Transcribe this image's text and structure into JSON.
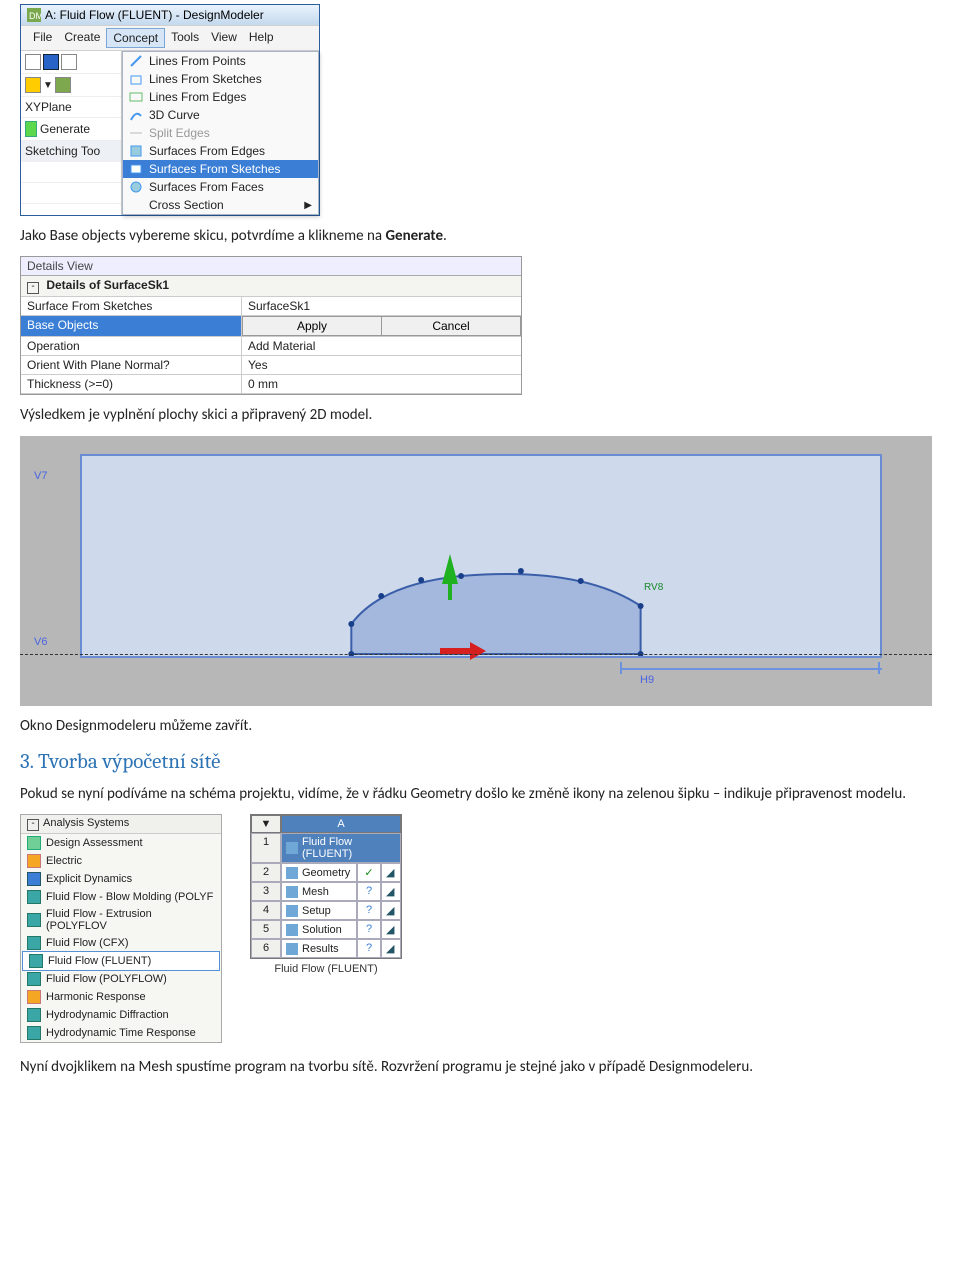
{
  "dm": {
    "title": "A: Fluid Flow (FLUENT) - DesignModeler",
    "menus": [
      "File",
      "Create",
      "Concept",
      "Tools",
      "View",
      "Help"
    ],
    "open_menu_index": 2,
    "left": {
      "plane": "XYPlane",
      "generate": "Generate",
      "sketch": "Sketching Too"
    },
    "dropdown": [
      {
        "label": "Lines From Points"
      },
      {
        "label": "Lines From Sketches"
      },
      {
        "label": "Lines From Edges"
      },
      {
        "label": "3D Curve"
      },
      {
        "label": "Split Edges",
        "disabled": true
      },
      {
        "label": "Surfaces From Edges"
      },
      {
        "label": "Surfaces From Sketches",
        "selected": true
      },
      {
        "label": "Surfaces From Faces"
      },
      {
        "label": "Cross Section",
        "submenu": true
      }
    ]
  },
  "para1": {
    "text_a": "Jako Base objects vybereme skicu, potvrdíme a klikneme na ",
    "bold": "Generate",
    "text_b": "."
  },
  "details": {
    "view_title": "Details View",
    "header": "Details of SurfaceSk1",
    "rows": [
      {
        "k": "Surface From Sketches",
        "v": "SurfaceSk1"
      },
      {
        "k": "Base Objects",
        "apply": "Apply",
        "cancel": "Cancel",
        "selected": true
      },
      {
        "k": "Operation",
        "v": "Add Material"
      },
      {
        "k": "Orient With Plane Normal?",
        "v": "Yes"
      },
      {
        "k": "Thickness (>=0)",
        "v": "0 mm"
      }
    ]
  },
  "para2": "Výsledkem je vyplnění plochy skici a připravený 2D model.",
  "model": {
    "v7": "V7",
    "v6": "V6",
    "h9": "H9",
    "rv": "RV8"
  },
  "para3": "Okno Designmodeleru můžeme zavřít.",
  "section3": {
    "num": "3. ",
    "title": "Tvorba výpočetní sítě"
  },
  "para4": "Pokud se nyní podíváme na schéma projektu, vidíme, že v řádku Geometry došlo ke změně ikony na zelenou šipku – indikuje připravenost modelu.",
  "wb": {
    "tree_header": "Analysis Systems",
    "tree": [
      {
        "label": "Design Assessment",
        "cls": "green"
      },
      {
        "label": "Electric",
        "cls": "orange"
      },
      {
        "label": "Explicit Dynamics",
        "cls": "blue"
      },
      {
        "label": "Fluid Flow - Blow Molding (POLYF",
        "cls": "teal"
      },
      {
        "label": "Fluid Flow - Extrusion (POLYFLOV",
        "cls": "teal"
      },
      {
        "label": "Fluid Flow (CFX)",
        "cls": "teal"
      },
      {
        "label": "Fluid Flow (FLUENT)",
        "cls": "teal",
        "selected": true
      },
      {
        "label": "Fluid Flow (POLYFLOW)",
        "cls": "teal"
      },
      {
        "label": "Harmonic Response",
        "cls": "orange"
      },
      {
        "label": "Hydrodynamic Diffraction",
        "cls": "teal"
      },
      {
        "label": "Hydrodynamic Time Response",
        "cls": "teal"
      }
    ],
    "table": {
      "col": "A",
      "caption": "Fluid Flow (FLUENT)",
      "rows": [
        {
          "n": "1",
          "label": "Fluid Flow (FLUENT)",
          "header": true
        },
        {
          "n": "2",
          "label": "Geometry",
          "status": "✓"
        },
        {
          "n": "3",
          "label": "Mesh",
          "status": "?"
        },
        {
          "n": "4",
          "label": "Setup",
          "status": "?"
        },
        {
          "n": "5",
          "label": "Solution",
          "status": "?"
        },
        {
          "n": "6",
          "label": "Results",
          "status": "?"
        }
      ]
    }
  },
  "para5": "Nyní dvojklikem na Mesh spustíme program na tvorbu sítě. Rozvržení programu je stejné jako v případě Designmodeleru."
}
